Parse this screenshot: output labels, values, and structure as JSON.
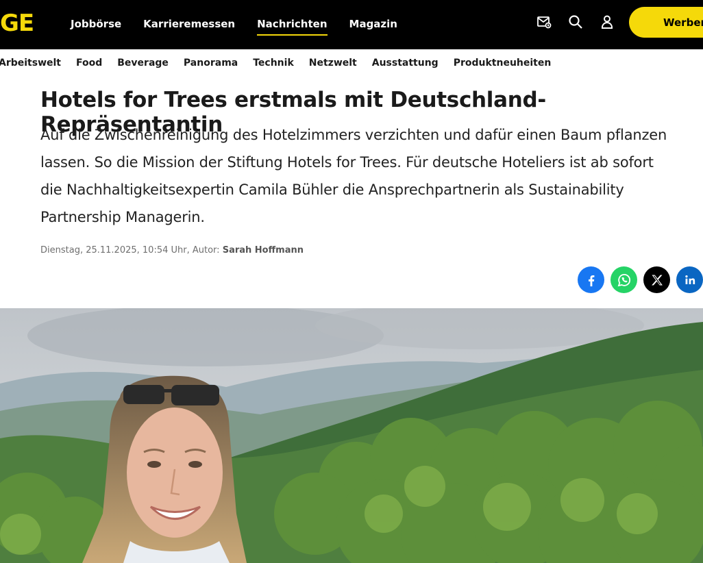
{
  "header": {
    "logo": "GE",
    "nav": [
      {
        "label": "Jobbörse"
      },
      {
        "label": "Karrieremessen"
      },
      {
        "label": "Nachrichten"
      },
      {
        "label": "Magazin"
      }
    ],
    "active_nav": "Nachrichten",
    "icons": [
      "mail-icon",
      "search-icon",
      "user-icon"
    ],
    "cta_label": "Werben"
  },
  "subnav": [
    {
      "label": "Arbeitswelt"
    },
    {
      "label": "Food"
    },
    {
      "label": "Beverage"
    },
    {
      "label": "Panorama"
    },
    {
      "label": "Technik"
    },
    {
      "label": "Netzwelt"
    },
    {
      "label": "Ausstattung"
    },
    {
      "label": "Produktneuheiten"
    }
  ],
  "article": {
    "headline": "Hotels for Trees erstmals mit Deutschland-Repräsentantin",
    "teaser": "Auf die Zwischenreinigung des Hotelzimmers verzichten und dafür einen Baum pflanzen lassen. So die Mission der Stiftung Hotels for Trees. Für deutsche Hoteliers ist ab sofort die Nachhaltigkeitsexpertin Camila Bühler die Ansprechpartnerin als Sustainability Partnership Managerin.",
    "meta_prefix": "Dienstag, 25.11.2025, 10:54 Uhr, Autor:",
    "author": "Sarah Hoffmann"
  },
  "share": [
    {
      "name": "facebook-icon",
      "color": "#1877f2",
      "glyph": "f"
    },
    {
      "name": "whatsapp-icon",
      "color": "#25d366",
      "glyph": ""
    },
    {
      "name": "x-icon",
      "color": "#000000",
      "glyph": "𝕏"
    },
    {
      "name": "linkedin-icon",
      "color": "#0a66c2",
      "glyph": "in"
    }
  ],
  "colors": {
    "brand_yellow": "#f5d90a",
    "topbar": "#000000"
  }
}
